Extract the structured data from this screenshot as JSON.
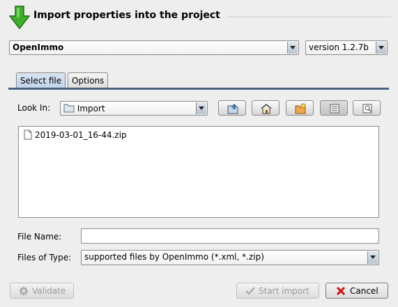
{
  "header": {
    "title": "Import properties into the project"
  },
  "format": {
    "selected": "OpenImmo"
  },
  "version": {
    "selected": "version 1.2.7b"
  },
  "tabs": [
    {
      "label": "Select file"
    },
    {
      "label": "Options"
    }
  ],
  "file_chooser": {
    "look_in_label": "Look In:",
    "look_in_value": "Import",
    "toolbar_icons": [
      "up-folder-icon",
      "home-icon",
      "new-folder-icon",
      "list-view-icon",
      "details-view-icon"
    ],
    "files": [
      {
        "name": "2019-03-01_16-44.zip"
      }
    ],
    "file_name_label": "File Name:",
    "file_name_value": "",
    "files_of_type_label": "Files of Type:",
    "files_of_type_value": "supported files by OpenImmo (*.xml, *.zip)"
  },
  "buttons": {
    "validate": "Validate",
    "start_import": "Start import",
    "cancel": "Cancel"
  },
  "colors": {
    "accent": "#5b7290",
    "arrow_green": "#3fae2a",
    "cancel_red": "#d01010"
  }
}
